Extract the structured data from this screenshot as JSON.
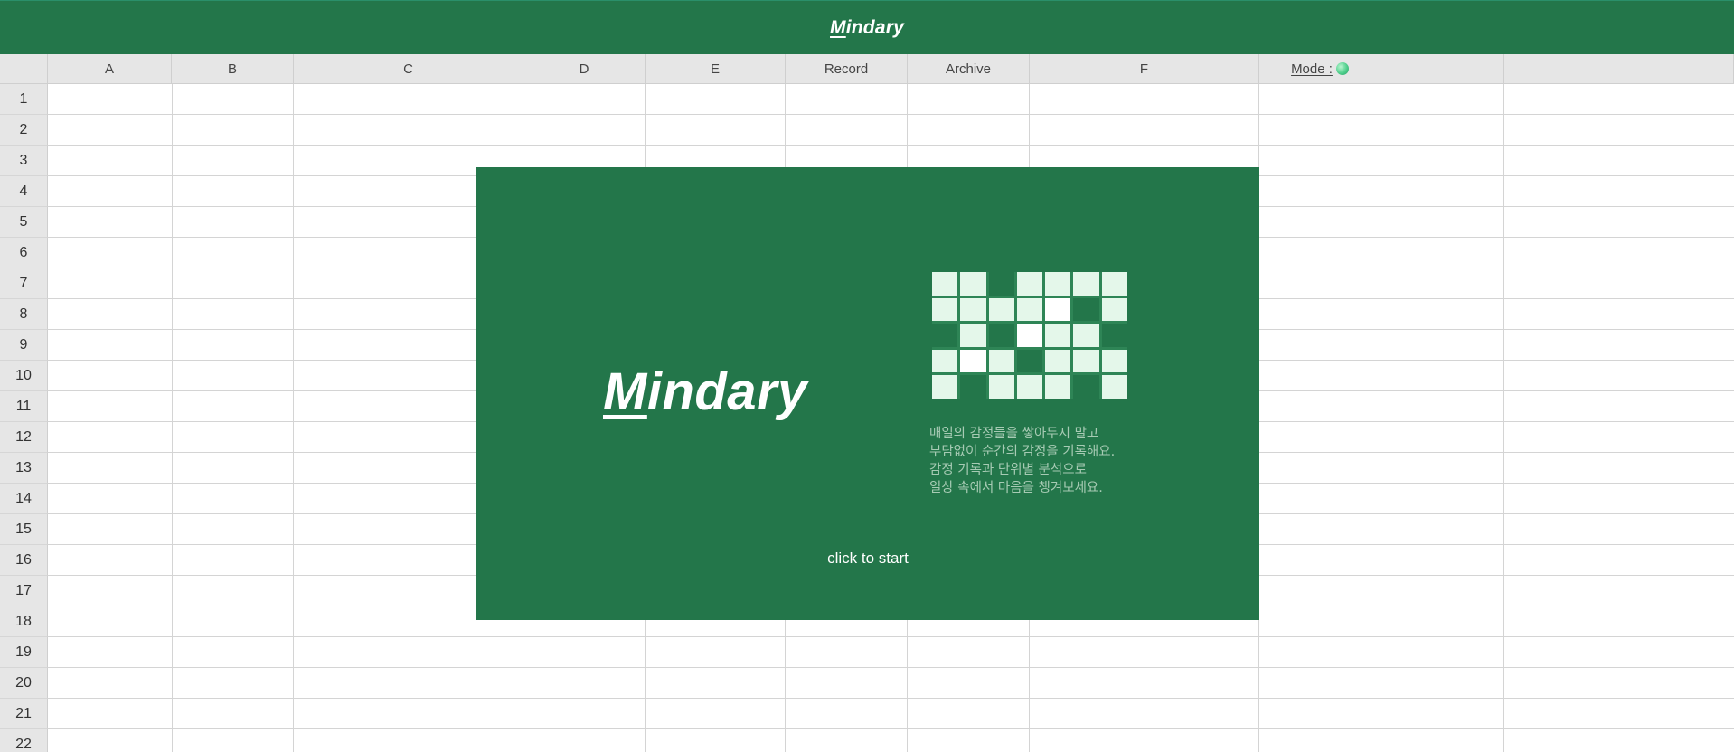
{
  "app": {
    "title_m": "M",
    "title_rest": "indary"
  },
  "columns": [
    "A",
    "B",
    "C",
    "D",
    "E",
    "Record",
    "Archive",
    "F",
    "Mode :",
    "",
    ""
  ],
  "rows": [
    "1",
    "2",
    "3",
    "4",
    "5",
    "6",
    "7",
    "8",
    "9",
    "10",
    "11",
    "12",
    "13",
    "14",
    "15",
    "16",
    "17",
    "18",
    "19",
    "20",
    "21",
    "22"
  ],
  "mode": {
    "label": "Mode :",
    "indicator_color": "#4fcf8c"
  },
  "intro": {
    "logo_m": "M",
    "logo_rest": "indary",
    "pixel_pattern": [
      [
        "light",
        "light",
        "dark",
        "light",
        "light",
        "light",
        "light"
      ],
      [
        "light",
        "light",
        "light",
        "light",
        "white",
        "dark",
        "light"
      ],
      [
        "dark",
        "light",
        "dark",
        "white",
        "light",
        "light",
        "dark"
      ],
      [
        "light",
        "white",
        "light",
        "dark",
        "light",
        "light",
        "light"
      ],
      [
        "light",
        "dark",
        "light",
        "light",
        "light",
        "dark",
        "light"
      ]
    ],
    "description": [
      "매일의 감정들을 쌓아두지 말고",
      "부담없이 순간의 감정을 기록해요.",
      "감정 기록과 단위별 분석으로",
      "일상 속에서 마음을 챙겨보세요."
    ],
    "start_label": "click to start"
  },
  "colors": {
    "brand_green": "#23764a",
    "header_gray": "#e6e6e6"
  }
}
